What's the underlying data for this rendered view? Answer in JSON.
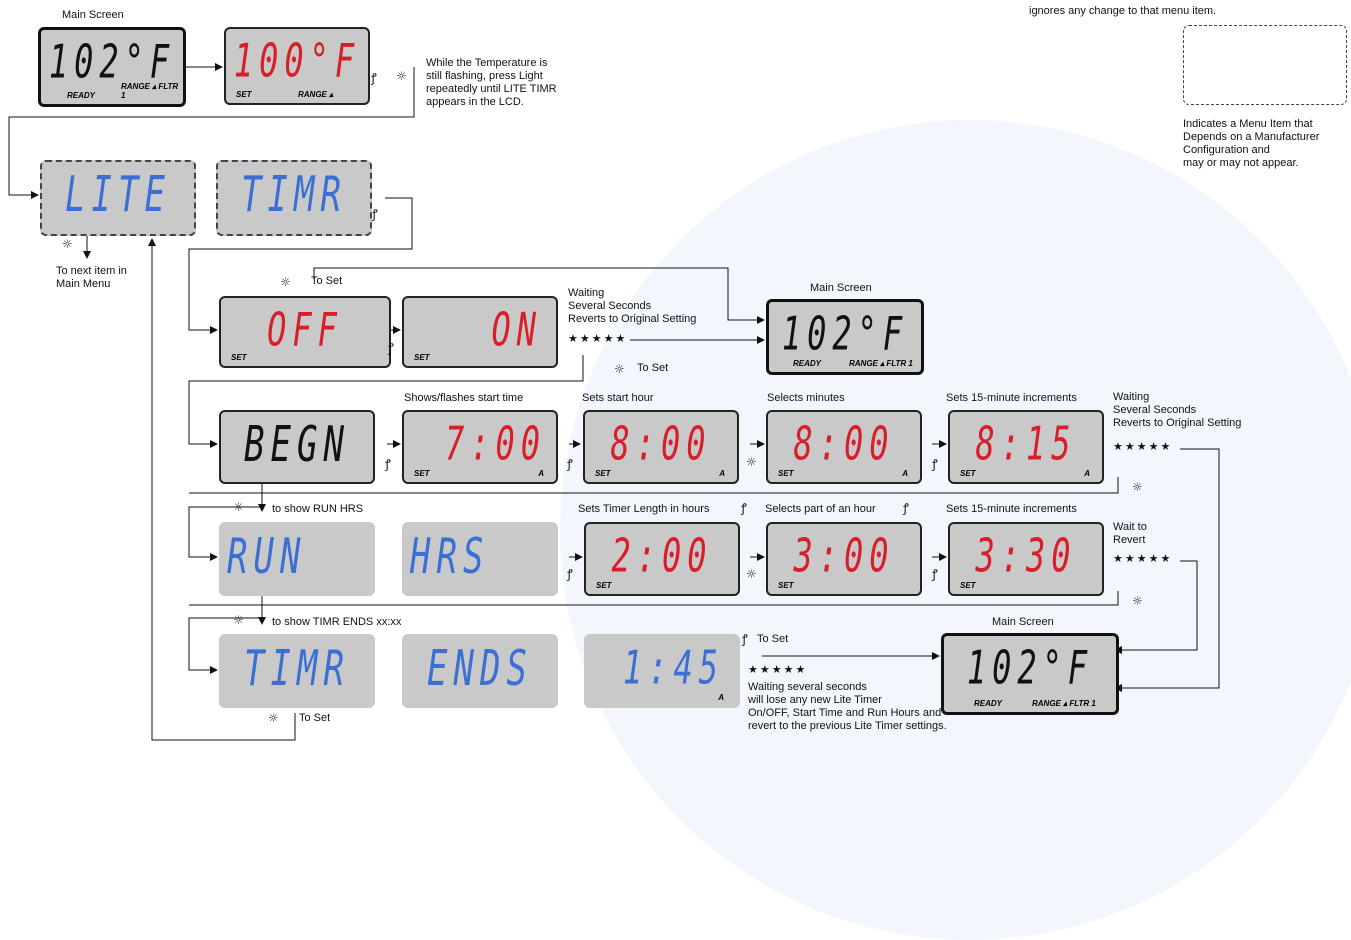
{
  "header_note": "ignores any change to that menu item.",
  "legend": {
    "text": "Indicates a Menu Item that\nDepends on a Manufacturer\nConfiguration and\nmay or may not appear."
  },
  "icons": {
    "light": "light-button-icon",
    "temp": "temp-button-icon",
    "light_glyph": "☼",
    "temp_glyph": "ꝭ"
  },
  "colors": {
    "red": "#d81e2a",
    "blue": "#3b6fd4",
    "lcd": "#c9c9c9"
  },
  "stars": "★★★★★",
  "labels": {
    "main_screen": "Main Screen",
    "flash_note": "While the Temperature is\nstill flashing, press Light\nrepeatedly until LITE TIMR\nappears in the LCD.",
    "next_item": "To next item in\nMain Menu",
    "to_set": "To Set",
    "waiting_several": "Waiting\nSeveral Seconds\nReverts to Original Setting",
    "shows_start": "Shows/flashes start time",
    "sets_hour": "Sets start hour",
    "selects_minutes": "Selects minutes",
    "sets_15": "Sets 15-minute increments",
    "show_run": "to show RUN HRS",
    "sets_length": "Sets Timer Length in hours",
    "selects_part": "Selects part of an hour",
    "wait_revert": "Wait to\nRevert",
    "show_ends": "to show TIMR ENDS xx:xx",
    "losing_note": "Waiting several seconds\nwill lose any new Lite Timer\nOn/OFF, Start Time and Run Hours and\nrevert to the previous Lite Timer settings."
  },
  "screens": {
    "main1": {
      "text": "102°F",
      "ind": [
        "READY",
        "RANGE ▴ FLTR 1"
      ]
    },
    "set100": {
      "text": "100°F",
      "ind": [
        "SET",
        "RANGE ▴"
      ]
    },
    "lite": {
      "text": "LITE"
    },
    "timr": {
      "text": "TIMR"
    },
    "off": {
      "text": "OFF",
      "ind": [
        "SET"
      ]
    },
    "on": {
      "text": "ON",
      "ind": [
        "SET"
      ]
    },
    "main2": {
      "text": "102°F",
      "ind": [
        "READY",
        "RANGE ▴ FLTR 1"
      ]
    },
    "begn": {
      "text": "BEGN"
    },
    "t700": {
      "text": "7:00",
      "ind": [
        "SET",
        "A"
      ]
    },
    "t800": {
      "text": "8:00",
      "ind": [
        "SET",
        "A"
      ]
    },
    "t800b": {
      "text": "8:00",
      "ind": [
        "SET",
        "A"
      ]
    },
    "t815": {
      "text": "8:15",
      "ind": [
        "SET",
        "A"
      ]
    },
    "run": {
      "text": "RUN"
    },
    "hrs": {
      "text": "HRS"
    },
    "t200": {
      "text": "2:00",
      "ind": [
        "SET"
      ]
    },
    "t300": {
      "text": "3:00",
      "ind": [
        "SET"
      ]
    },
    "t330": {
      "text": "3:30",
      "ind": [
        "SET"
      ]
    },
    "timr2": {
      "text": "TIMR"
    },
    "ends": {
      "text": "ENDS"
    },
    "t145": {
      "text": "1:45",
      "ind": [
        "A"
      ]
    },
    "main3": {
      "text": "102°F",
      "ind": [
        "READY",
        "RANGE ▴ FLTR 1"
      ]
    }
  }
}
